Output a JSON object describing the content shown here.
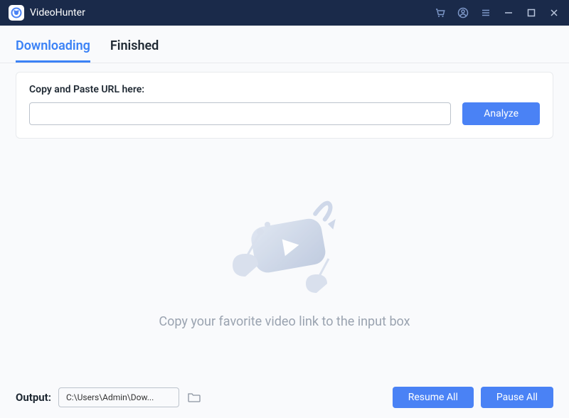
{
  "app_title": "VideoHunter",
  "tabs": {
    "downloading": "Downloading",
    "finished": "Finished"
  },
  "url_card": {
    "label": "Copy and Paste URL here:",
    "analyze_btn": "Analyze",
    "input_value": ""
  },
  "empty_state": {
    "message": "Copy your favorite video link to the input box"
  },
  "footer": {
    "output_label": "Output:",
    "output_path": "C:\\Users\\Admin\\Dow...",
    "resume_btn": "Resume All",
    "pause_btn": "Pause All"
  },
  "colors": {
    "titlebar_bg": "#1a2a4a",
    "accent": "#4a82f5"
  }
}
